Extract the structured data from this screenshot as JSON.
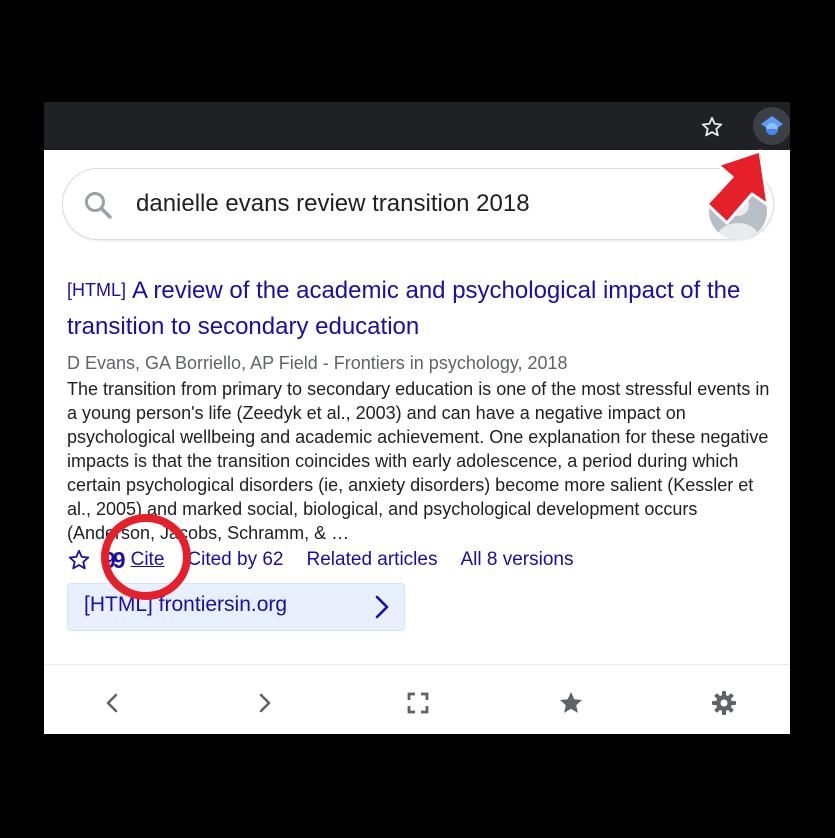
{
  "search": {
    "query": "danielle evans review transition 2018"
  },
  "result": {
    "tag": "[HTML]",
    "title": "A review of the academic and psychological impact of the transition to secondary education",
    "meta": "D Evans, GA Borriello, AP Field - Frontiers in psychology, 2018",
    "snippet": "The transition from primary to secondary education is one of the most stressful events in a young person's life (Zeedyk et al., 2003) and can have a negative impact on psychological wellbeing and academic achievement. One explanation for these negative impacts is that the transition coincides with early adolescence, a period during which certain psychological disorders (ie, anxiety disorders) become more salient (Kessler et al., 2005) and marked social, biological, and psychological development occurs (Anderson, Jacobs, Schramm, & …",
    "actions": {
      "cite_icon": "99",
      "cite": "Cite",
      "cited_by": "Cited by 62",
      "related": "Related articles",
      "versions": "All 8 versions"
    },
    "fulltext": "[HTML] frontiersin.org"
  },
  "icons": {
    "search": "search-icon",
    "bookmark": "star-outline-icon",
    "extension": "scholar-extension-icon",
    "back": "chevron-left-icon",
    "forward": "chevron-right-icon",
    "fullscreen": "fullscreen-icon",
    "starred": "star-filled-icon",
    "settings": "gear-icon"
  },
  "colors": {
    "link": "#1a0dab",
    "toolbar": "#202124",
    "fulltext_bg": "#e8f0fe",
    "annotation": "#e5202a",
    "extension_blue": "#4285f4"
  }
}
